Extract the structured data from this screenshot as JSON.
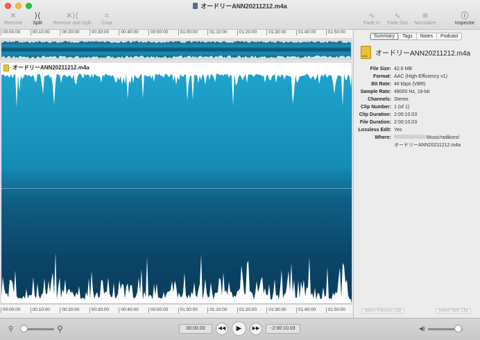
{
  "window": {
    "title": "オードリーANN20211212.m4a"
  },
  "toolbar": {
    "remove": "Remove",
    "split": "Split",
    "remove_and_split": "Remove and Split",
    "crop": "Crop",
    "fade_in": "Fade In",
    "fade_out": "Fade Out",
    "normalize": "Normalize",
    "inspector": "Inspector"
  },
  "ruler": {
    "ticks": [
      "00:00:00",
      "00:10:00",
      "00:20:00",
      "00:30:00",
      "00:40:00",
      "00:50:00",
      "01:00:00",
      "01:10:00",
      "01:20:00",
      "01:30:00",
      "01:40:00",
      "01:50:00"
    ]
  },
  "clip": {
    "name": "オードリーANN20211212.m4a"
  },
  "inspector": {
    "tabs": [
      "Summary",
      "Tags",
      "Notes",
      "Podcast"
    ],
    "active_tab": "Summary",
    "file_name": "オードリーANN20211212.m4a",
    "properties": [
      {
        "k": "File Size:",
        "v": "42.8 MB"
      },
      {
        "k": "Format:",
        "v": "AAC (High-Efficiency v1)"
      },
      {
        "k": "Bit Rate:",
        "v": "46 kbps (VBR)"
      },
      {
        "k": "Sample Rate:",
        "v": "48000 Hz, 16-bit"
      },
      {
        "k": "Channels:",
        "v": "Stereo"
      },
      {
        "k": "Clip Number:",
        "v": "1 (of 1)"
      },
      {
        "k": "Clip Duration:",
        "v": "2:00:10.03"
      },
      {
        "k": "File Duration:",
        "v": "2:00:10.03"
      },
      {
        "k": "Lossless Edit:",
        "v": "Yes"
      }
    ],
    "where_label": "Where:",
    "where_line1": "Music/radikoro/",
    "where_line2": "オードリーANN20211212.m4a",
    "select_previous": "Select Previous Clip",
    "select_next": "Select Next Clip"
  },
  "transport": {
    "current_time": "00:00.00",
    "remaining_time": "-2:00:10.03"
  },
  "icons": {
    "remove": "x-icon",
    "split": "split-icon",
    "crop": "crop-icon",
    "rewind": "rewind-icon",
    "play": "play-icon",
    "forward": "fast-forward-icon",
    "zoom_out": "zoom-out-icon",
    "zoom_in": "zoom-in-icon",
    "volume": "volume-icon",
    "info": "info-icon"
  },
  "colors": {
    "wave_top": "#1fa3cc",
    "wave_bottom": "#0a3c5c",
    "wave_peak": "#ffffff"
  }
}
